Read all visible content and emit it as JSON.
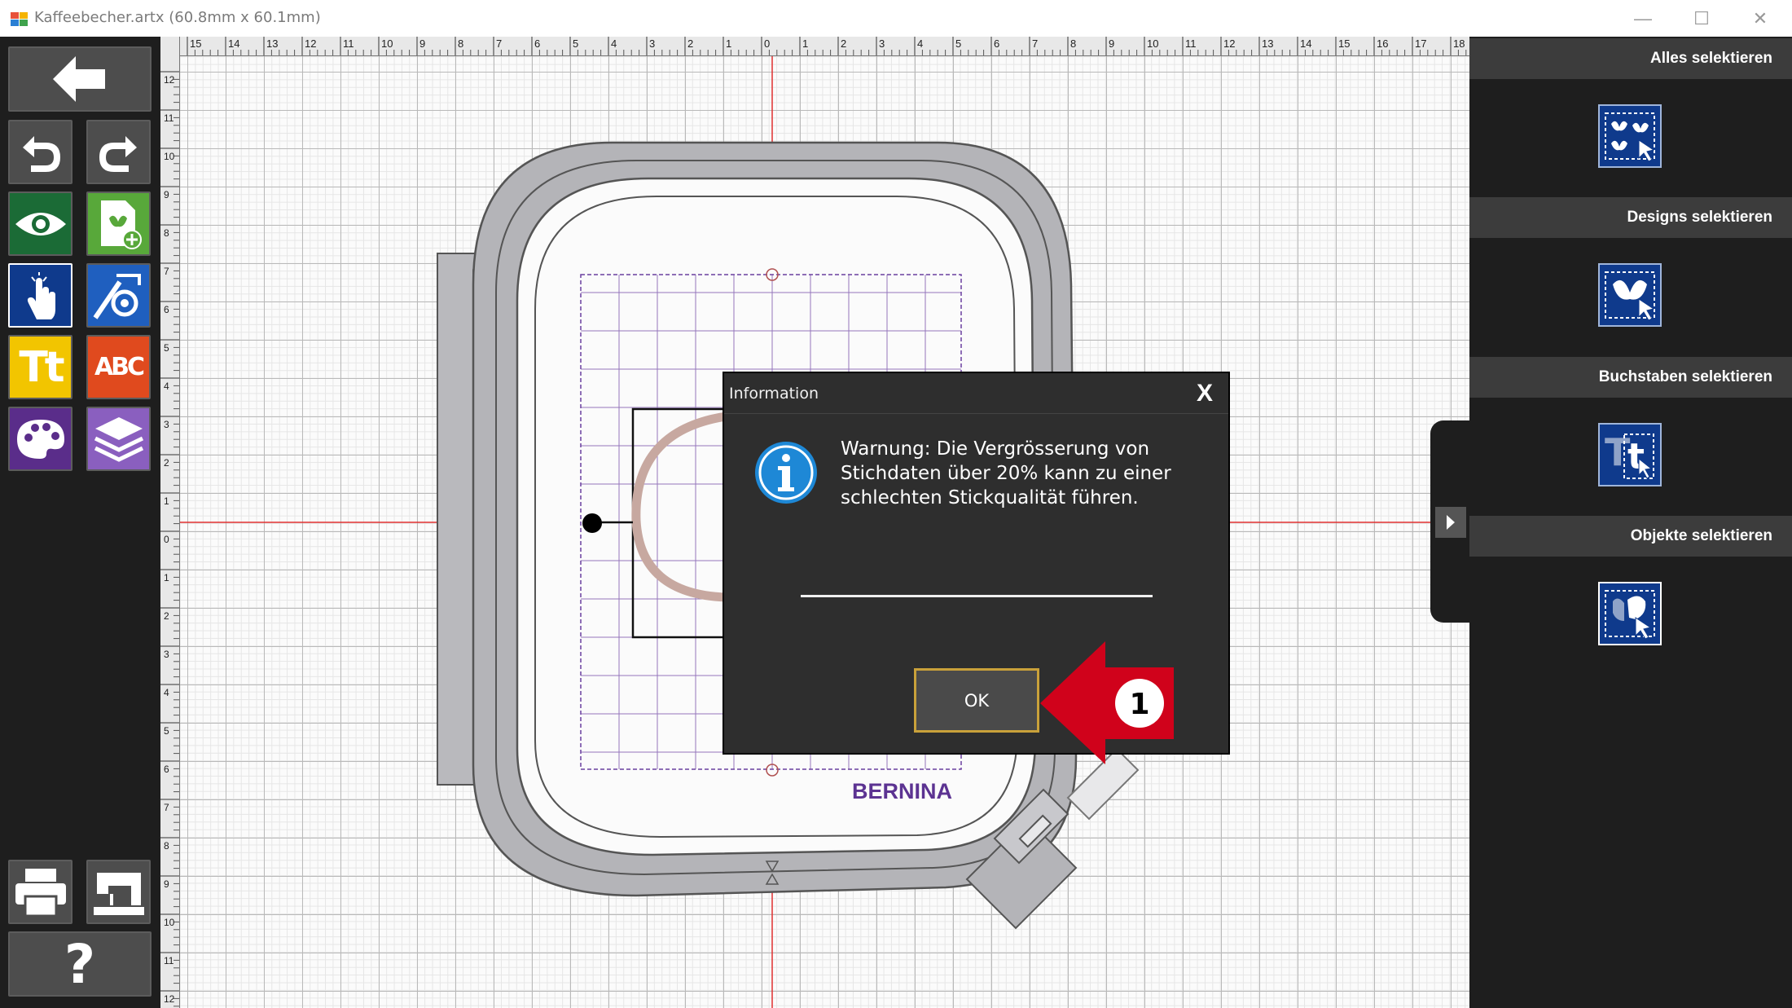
{
  "window": {
    "title": "Kaffeebecher.artx (60.8mm x 60.1mm)",
    "minimize": "—",
    "maximize": "☐",
    "close": "✕"
  },
  "toolbar": {
    "buttons": [
      {
        "name": "back",
        "icon": "back-arrow-icon"
      },
      {
        "name": "undo",
        "icon": "undo-icon"
      },
      {
        "name": "redo",
        "icon": "redo-icon"
      },
      {
        "name": "preview",
        "icon": "eye-icon"
      },
      {
        "name": "add-design",
        "icon": "add-design-icon"
      },
      {
        "name": "select",
        "icon": "hand-pointer-icon"
      },
      {
        "name": "edit-design",
        "icon": "design-edit-icon"
      },
      {
        "name": "text",
        "icon": "text-icon",
        "label": "Tt"
      },
      {
        "name": "monogram",
        "icon": "monogram-icon",
        "label": "ABC"
      },
      {
        "name": "colors",
        "icon": "palette-icon"
      },
      {
        "name": "layers",
        "icon": "layers-icon"
      },
      {
        "name": "print",
        "icon": "printer-icon"
      },
      {
        "name": "send-to-machine",
        "icon": "sewing-machine-icon"
      },
      {
        "name": "help",
        "icon": "help-icon",
        "label": "?"
      }
    ]
  },
  "rulers": {
    "horizontal": [
      "15",
      "14",
      "13",
      "12",
      "11",
      "10",
      "9",
      "8",
      "7",
      "6",
      "5",
      "4",
      "3",
      "2",
      "1",
      "0",
      "1",
      "2",
      "3",
      "4",
      "5",
      "6",
      "7",
      "8",
      "9",
      "10",
      "11",
      "12",
      "13",
      "14",
      "15",
      "16",
      "17",
      "18"
    ],
    "vertical": [
      "12",
      "11",
      "10",
      "9",
      "8",
      "7",
      "6",
      "5",
      "4",
      "3",
      "2",
      "1",
      "0",
      "1",
      "2",
      "3",
      "4",
      "5",
      "6",
      "7",
      "8",
      "9",
      "10",
      "11",
      "12"
    ]
  },
  "canvas": {
    "hoop_brand": "BERNINA"
  },
  "right_panel": {
    "sections": [
      {
        "label": "Alles selektieren",
        "icon": "select-all-icon"
      },
      {
        "label": "Designs selektieren",
        "icon": "select-designs-icon"
      },
      {
        "label": "Buchstaben selektieren",
        "icon": "select-letters-icon"
      },
      {
        "label": "Objekte selektieren",
        "icon": "select-objects-icon"
      }
    ]
  },
  "dialog": {
    "title": "Information",
    "close": "X",
    "message": "Warnung: Die Vergrösserung von Stichdaten über 20% kann zu einer schlechten Stickqualität führen.",
    "ok_label": "OK"
  },
  "callout": {
    "number": "1",
    "color": "#d0021b"
  },
  "colors": {
    "accent_blue": "#0f3a8c",
    "ok_border": "#c9a13a",
    "crosshair": "#e03030"
  }
}
